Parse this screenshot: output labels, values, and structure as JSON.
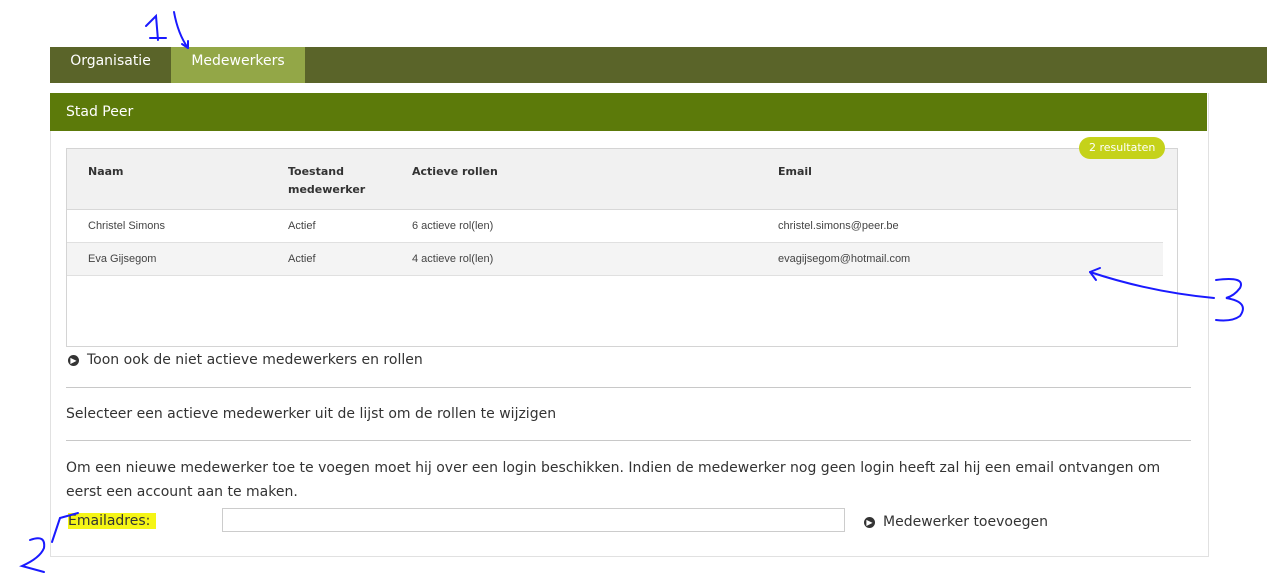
{
  "nav": {
    "tabs": [
      {
        "label": "Organisatie"
      },
      {
        "label": "Medewerkers"
      }
    ]
  },
  "panel": {
    "title": "Stad Peer",
    "results_badge": "2 resultaten"
  },
  "table": {
    "headers": {
      "naam": "Naam",
      "toestand_1": "Toestand",
      "toestand_2": "medewerker",
      "rollen": "Actieve rollen",
      "email": "Email"
    },
    "rows": [
      {
        "naam": "Christel Simons",
        "toestand": "Actief",
        "rollen": "6 actieve rol(len)",
        "email": "christel.simons@peer.be"
      },
      {
        "naam": "Eva Gijsegom",
        "toestand": "Actief",
        "rollen": "4 actieve rol(len)",
        "email": "evagijsegom@hotmail.com"
      }
    ]
  },
  "links": {
    "show_inactive": "Toon ook de niet actieve medewerkers en rollen",
    "add_employee": "Medewerker toevoegen"
  },
  "texts": {
    "select_hint": "Selecteer een actieve medewerker uit de lijst om de rollen te wijzigen",
    "new_employee_info": "Om een nieuwe medewerker toe te voegen moet hij over een login beschikken. Indien de medewerker nog geen login heeft zal hij een email ontvangen om eerst een account aan te maken."
  },
  "form": {
    "email_label": "Emailadres:",
    "email_value": "",
    "email_placeholder": ""
  },
  "annotations": {
    "one": "1",
    "two": "2",
    "three": "3",
    "color": "#1a1aff"
  },
  "colors": {
    "nav_bg": "#5a6429",
    "active_tab": "#93a747",
    "panel_header": "#5c7a0a",
    "badge": "#c5d21a",
    "highlight": "#f5f516"
  }
}
